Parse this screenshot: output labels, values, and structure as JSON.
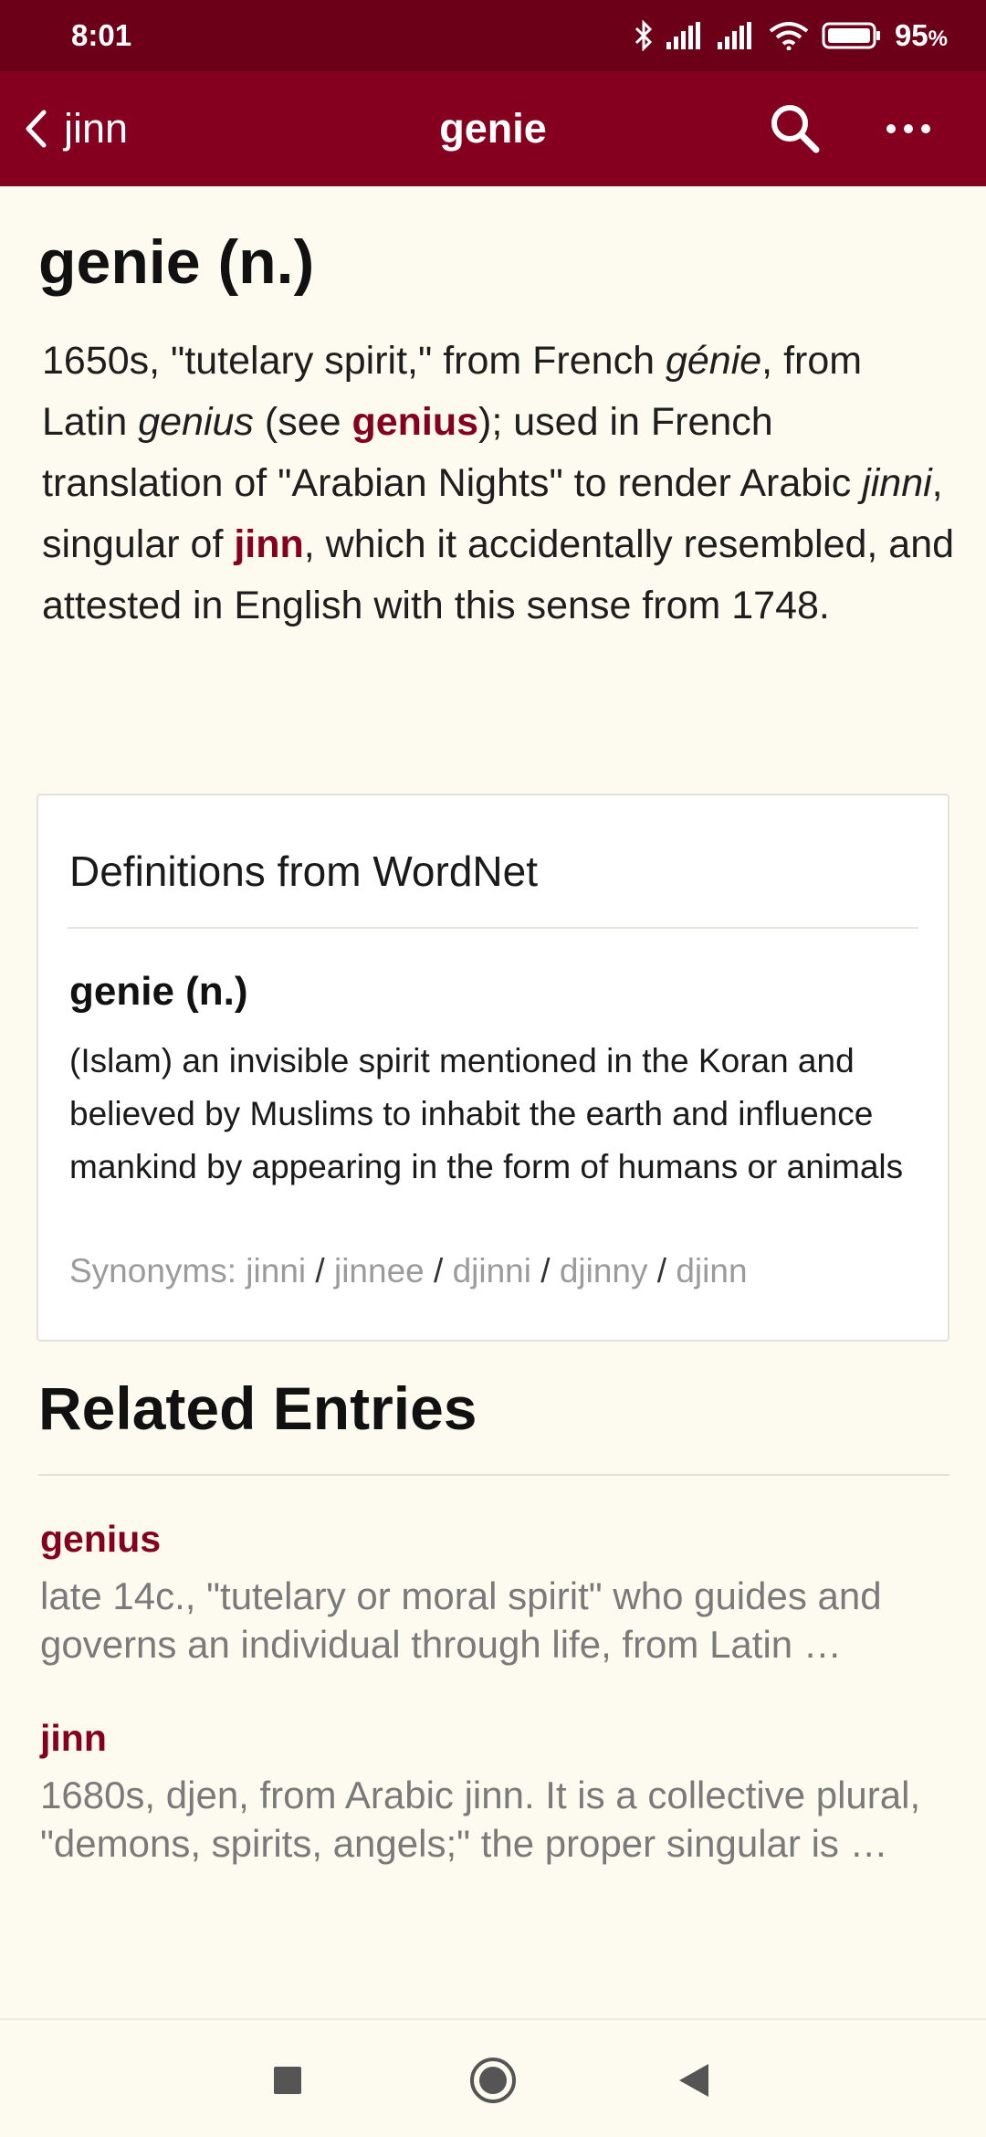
{
  "status_bar": {
    "time": "8:01",
    "battery_percent": "95",
    "battery_unit": "%",
    "icons": [
      "bluetooth-icon",
      "signal-icon",
      "signal-icon",
      "wifi-icon",
      "battery-icon"
    ]
  },
  "app_bar": {
    "back_label": "jinn",
    "title": "genie",
    "icons": [
      "chevron-left-icon",
      "search-icon",
      "more-icon"
    ]
  },
  "entry": {
    "title": "genie (n.)",
    "body": {
      "p1": "1650s, \"tutelary spirit,\" from French ",
      "i1": "génie",
      "p2": ", from Latin ",
      "i2": "genius",
      "p3": " (see ",
      "link1": "genius",
      "p4": "); used in French translation of \"Arabian Nights\" to render Arabic ",
      "i3": "jinni",
      "p5": ", singular of ",
      "link2": "jinn",
      "p6": ", which it accidentally resembled, and attested in English with this sense from 1748."
    }
  },
  "wordnet": {
    "heading": "Definitions from WordNet",
    "word": "genie (n.)",
    "definition": "(Islam) an invisible spirit mentioned in the Koran and believed by Muslims to inhabit the earth and influence mankind by appearing in the form of humans or animals",
    "synonyms_label": "Synonyms:",
    "synonyms": [
      "jinni",
      "jinnee",
      "djinni",
      "djinny",
      "djinn"
    ],
    "separator": "/"
  },
  "related": {
    "title": "Related Entries",
    "items": [
      {
        "word": "genius",
        "snippet": "late 14c., \"tutelary or moral spirit\" who guides and governs an individual through life, from Latin …"
      },
      {
        "word": "jinn",
        "snippet": "1680s, djen, from Arabic jinn. It is a collective plural, \"demons, spirits, angels;\" the proper singular is …"
      }
    ]
  },
  "nav_bar": {
    "icons": [
      "recents-icon",
      "home-icon",
      "back-triangle-icon"
    ]
  },
  "colors": {
    "status_bar": "#6b0018",
    "app_bar": "#85001f",
    "accent": "#85001f",
    "background": "#fdfbf0"
  }
}
